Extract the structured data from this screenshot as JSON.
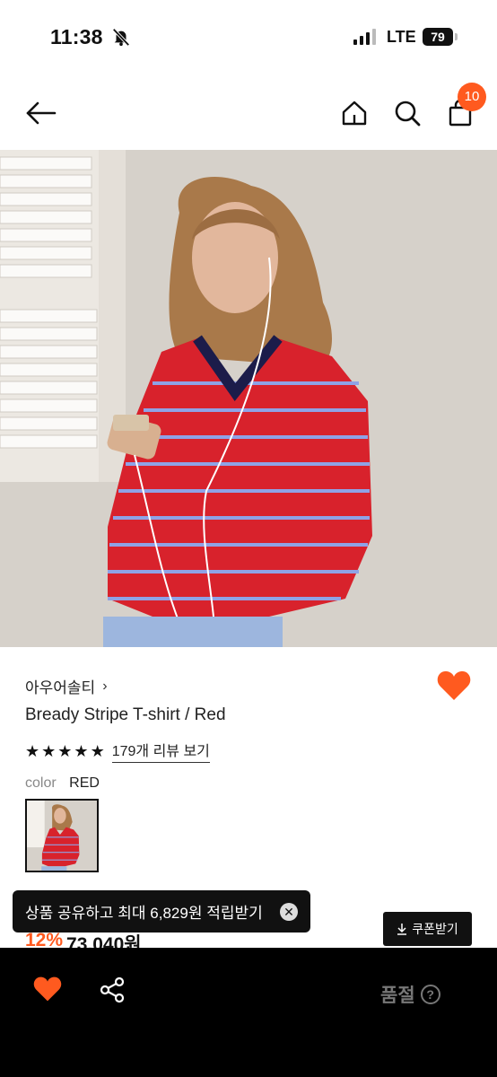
{
  "status_bar": {
    "time": "11:38",
    "network": "LTE",
    "battery": "79"
  },
  "nav": {
    "cart_count": "10"
  },
  "product": {
    "brand": "아우어솔티",
    "name": "Bready Stripe T-shirt / Red",
    "rating_stars": 5,
    "review_link": "179개 리뷰 보기",
    "color_label": "color",
    "color_value": "RED",
    "discount": "12%",
    "price": "73,040원"
  },
  "toast": {
    "message": "상품 공유하고 최대 6,829원 적립받기"
  },
  "coupon": {
    "label": "쿠폰받기"
  },
  "bottom_bar": {
    "status_label": "품절"
  },
  "colors": {
    "accent": "#ff5a1f",
    "sweater": "#d8222c",
    "stripe": "#8fa2e6"
  },
  "icons": [
    "bell-slash-icon",
    "signal-icon",
    "back-arrow-icon",
    "home-icon",
    "search-icon",
    "shopping-bag-icon",
    "heart-icon",
    "chevron-right-icon",
    "star-icon",
    "close-icon",
    "download-icon",
    "share-icon",
    "help-icon"
  ]
}
